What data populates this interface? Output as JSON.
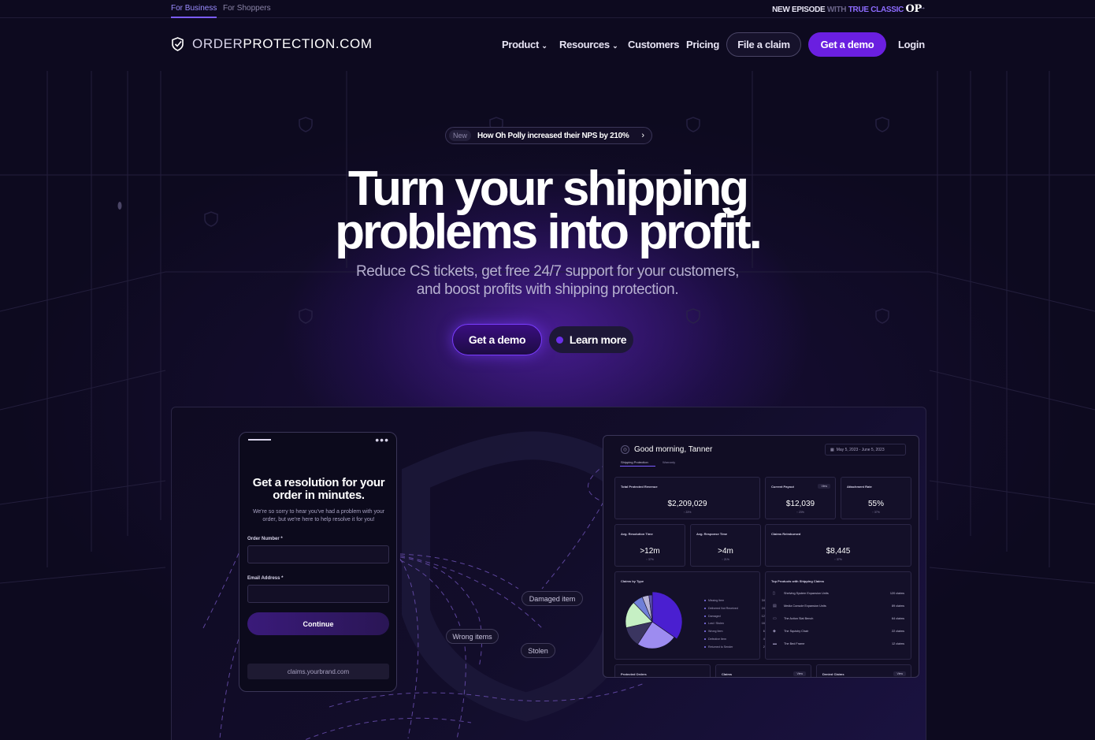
{
  "topbar": {
    "audience": [
      "For Business",
      "For Shoppers"
    ],
    "episode": {
      "part1": "NEW EPISODE",
      "part2": "WITH",
      "part3": "TRUE CLASSIC",
      "logo": "OP",
      "arrow": "→"
    }
  },
  "nav": {
    "brand_light": "ORDER",
    "brand_bold": "PROTECTION.COM",
    "items": [
      "Product",
      "Resources",
      "Customers",
      "Pricing"
    ],
    "claim_label": "File a claim",
    "demo_label": "Get a demo",
    "login_label": "Login"
  },
  "announcement": {
    "tag": "New",
    "text": "How Oh Polly increased their NPS by 210%",
    "arrow": "›"
  },
  "hero": {
    "title_line1": "Turn your shipping",
    "title_line2": "problems into profit.",
    "subtitle_line1": "Reduce CS tickets, get free 24/7 support for your customers,",
    "subtitle_line2": "and boost profits with shipping protection.",
    "cta_primary": "Get a demo",
    "cta_secondary": "Learn more"
  },
  "claim_form": {
    "title": "Get a resolution for your order in minutes.",
    "description": "We're so sorry to hear you've had a problem with your order, but we're here to help resolve it for you!",
    "order_label": "Order Number *",
    "email_label": "Email Address *",
    "continue_label": "Continue",
    "url": "claims.yourbrand.com",
    "dots": "•••"
  },
  "chips": [
    "Damaged item",
    "Wrong items",
    "Stolen"
  ],
  "dashboard": {
    "greeting": "Good morning, Tanner",
    "date_range": "May 5, 2023 - June 5, 2023",
    "tabs": [
      "Shipping Protection",
      "Warranty"
    ],
    "metrics": [
      {
        "label": "Total Protected Revenue",
        "value": "$2,209,029",
        "sub": "↑ 23%"
      },
      {
        "label": "Current Payout",
        "value": "$12,039",
        "sub": "↑ 23%",
        "action": "View"
      },
      {
        "label": "Attachment Rate",
        "value": "55%",
        "sub": "↑ 37%"
      },
      {
        "label": "Avg. Resolution Time",
        "value": ">12m",
        "sub": "↑ 37%"
      },
      {
        "label": "Avg. Response Time",
        "value": ">4m",
        "sub": "↑ 21%"
      },
      {
        "label": "Claims Reimbursed",
        "value": "$8,445",
        "sub": "↑ 37%"
      }
    ],
    "claims_by_type": {
      "title": "Claims by Type",
      "items": [
        {
          "label": "Missing Item",
          "pct": "34%",
          "value": 34,
          "color": "#4a1fd0"
        },
        {
          "label": "Delivered Not Received",
          "pct": "24%",
          "value": 24,
          "color": "#9d8cf0"
        },
        {
          "label": "Damaged",
          "pct": "12%",
          "value": 12,
          "color": "#3a3560"
        },
        {
          "label": "Lost / Stolen",
          "pct": "16%",
          "value": 16,
          "color": "#c6f0c4"
        },
        {
          "label": "Wrong Item",
          "pct": "6%",
          "value": 6,
          "color": "#6f7fd8"
        },
        {
          "label": "Defective Item",
          "pct": "4%",
          "value": 4,
          "color": "#b8b4d8"
        },
        {
          "label": "Returned to Sender",
          "pct": "2%",
          "value": 2,
          "color": "#5b4fb0"
        }
      ]
    },
    "top_products": {
      "title": "Top Products with Shipping Claims",
      "items": [
        {
          "name": "Shelving System Expansion Units",
          "claims": "120 claims"
        },
        {
          "name": "Media Console Expansion Units",
          "claims": "89 claims"
        },
        {
          "name": "The Action Slat Bench",
          "claims": "64 claims"
        },
        {
          "name": "The Squishy Chair",
          "claims": "22 claims"
        },
        {
          "name": "The Bed Frame",
          "claims": "12 claims"
        }
      ]
    },
    "bottom_cards": [
      {
        "label": "Protected Orders"
      },
      {
        "label": "Claims",
        "action": "View"
      },
      {
        "label": "Denied Claims",
        "action": "View"
      }
    ]
  }
}
